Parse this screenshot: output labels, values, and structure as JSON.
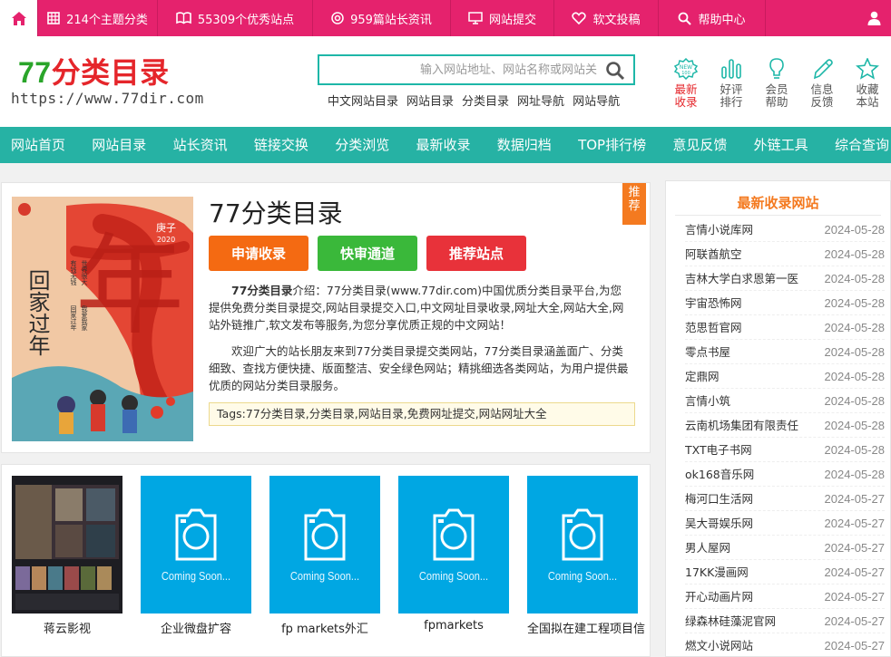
{
  "topbar": {
    "items": [
      {
        "label": "214个主题分类",
        "icon": "grid-icon"
      },
      {
        "label": "55309个优秀站点",
        "icon": "book-icon"
      },
      {
        "label": "959篇站长资讯",
        "icon": "target-icon"
      },
      {
        "label": "网站提交",
        "icon": "monitor-icon"
      },
      {
        "label": "软文投稿",
        "icon": "heart-icon"
      },
      {
        "label": "帮助中心",
        "icon": "search-icon"
      }
    ]
  },
  "header": {
    "logo_num": "77",
    "logo_text": "分类目录",
    "logo_url": "https://www.77dir.com",
    "search_placeholder": "输入网站地址、网站名称或网站关",
    "hotlinks": [
      "中文网站目录",
      "网站目录",
      "分类目录",
      "网址导航",
      "网站导航"
    ],
    "quick": [
      {
        "l1": "最新",
        "l2": "收录",
        "icon": "new-icon"
      },
      {
        "l1": "好评",
        "l2": "排行",
        "icon": "bar-chart-icon"
      },
      {
        "l1": "会员",
        "l2": "帮助",
        "icon": "bulb-icon"
      },
      {
        "l1": "信息",
        "l2": "反馈",
        "icon": "pencil-icon"
      },
      {
        "l1": "收藏",
        "l2": "本站",
        "icon": "star-icon"
      }
    ]
  },
  "nav": [
    "网站首页",
    "网站目录",
    "站长资讯",
    "链接交换",
    "分类浏览",
    "最新收录",
    "数据归档",
    "TOP排行榜",
    "意见反馈",
    "外链工具",
    "综合查询"
  ],
  "intro": {
    "title": "77分类目录",
    "badge": "推荐",
    "buttons": [
      "申请收录",
      "快审通道",
      "推荐站点"
    ],
    "p1_bold": "77分类目录",
    "p1": "介绍：77分类目录(www.77dir.com)中国优质分类目录平台,为您提供免费分类目录提交,网站目录提交入口,中文网址目录收录,网址大全,网站大全,网站外链推广,软文发布等服务,为您分享优质正规的中文网站！",
    "p2": "欢迎广大的站长朋友来到77分类目录提交类网站，77分类目录涵盖面广、分类细致、查找方便快捷、版面整洁、安全绿色网站；精挑细选各类网站，为用户提供最优质的网站分类目录服务。",
    "tags": "Tags:77分类目录,分类目录,网站目录,免费网址提交,网站网址大全",
    "poster": {
      "big_char": "年",
      "vertical": "回家过年",
      "year": "庚子",
      "year_num": "2020",
      "slogan1": "世界很大",
      "slogan2": "我爱我家",
      "slogan3": "有钱无钱",
      "slogan4": "回家过年"
    }
  },
  "thumbs": {
    "coming_soon": "Coming Soon...",
    "items": [
      "蒋云影视",
      "企业微盘扩容",
      "fp markets外汇",
      "fpmarkets",
      "全国拟在建工程项目信"
    ]
  },
  "sidebar": {
    "title": "最新收录网站",
    "items": [
      {
        "name": "言情小说库网",
        "date": "2024-05-28"
      },
      {
        "name": "阿联酋航空",
        "date": "2024-05-28"
      },
      {
        "name": "吉林大学白求恩第一医",
        "date": "2024-05-28"
      },
      {
        "name": "宇宙恐怖网",
        "date": "2024-05-28"
      },
      {
        "name": "范思哲官网",
        "date": "2024-05-28"
      },
      {
        "name": "零点书屋",
        "date": "2024-05-28"
      },
      {
        "name": "定鼎网",
        "date": "2024-05-28"
      },
      {
        "name": "言情小筑",
        "date": "2024-05-28"
      },
      {
        "name": "云南机场集团有限责任",
        "date": "2024-05-28"
      },
      {
        "name": "TXT电子书网",
        "date": "2024-05-28"
      },
      {
        "name": "ok168音乐网",
        "date": "2024-05-28"
      },
      {
        "name": "梅河口生活网",
        "date": "2024-05-27"
      },
      {
        "name": "吴大哥娱乐网",
        "date": "2024-05-27"
      },
      {
        "name": "男人屋网",
        "date": "2024-05-27"
      },
      {
        "name": "17KK漫画网",
        "date": "2024-05-27"
      },
      {
        "name": "开心动画片网",
        "date": "2024-05-27"
      },
      {
        "name": "绿森林硅藻泥官网",
        "date": "2024-05-27"
      },
      {
        "name": "燃文小说网站",
        "date": "2024-05-27"
      }
    ]
  },
  "colors": {
    "pink": "#e5226d",
    "teal": "#26b2a4",
    "orange": "#f47a20",
    "green": "#3ab83a",
    "red": "#e8323a",
    "sky": "#00a7e3"
  }
}
